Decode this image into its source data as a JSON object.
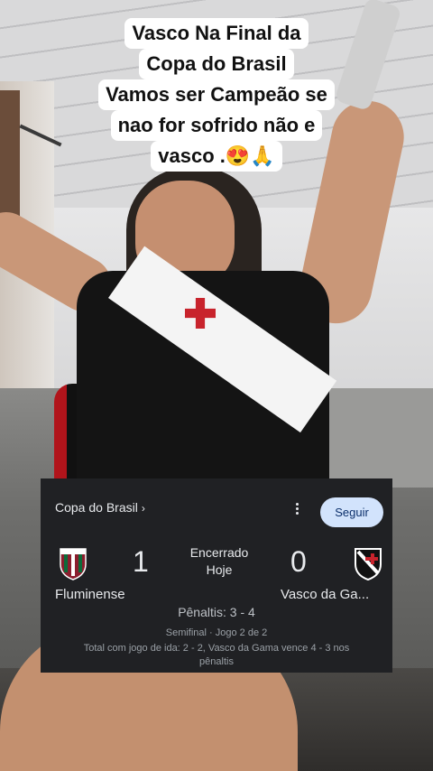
{
  "caption": {
    "lines": [
      "Vasco Na Final da",
      "Copa do Brasil",
      "Vamos ser Campeão se",
      "nao for sofrido não e",
      "vasco .😍🙏"
    ]
  },
  "match_card": {
    "competition": "Copa do Brasil",
    "competition_chevron": "›",
    "follow_label": "Seguir",
    "status_line1": "Encerrado",
    "status_line2": "Hoje",
    "home_team": {
      "name": "Fluminense",
      "score": "1",
      "logo": "fluminense-crest-icon"
    },
    "away_team": {
      "name": "Vasco da Ga...",
      "score": "0",
      "logo": "vasco-crest-icon"
    },
    "penalties": "Pênaltis: 3 - 4",
    "round": "Semifinal · Jogo 2 de 2",
    "aggregate": "Total com jogo de ida: 2 - 2, Vasco da Gama vence 4 - 3 nos pênaltis"
  },
  "colors": {
    "card_bg": "#202124",
    "follow_bg": "#d2e3fc",
    "caption_bg": "#ffffff",
    "fluminense_red": "#8b1e2e",
    "fluminense_green": "#0d6b3a",
    "vasco_black": "#111111"
  }
}
